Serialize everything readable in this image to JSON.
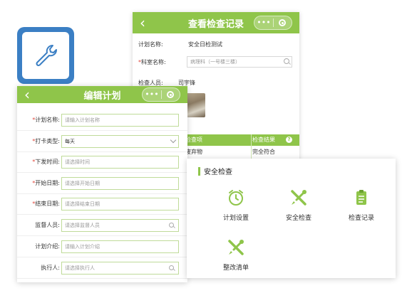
{
  "colors": {
    "accent": "#8fc54a",
    "tile_blue": "#3b7fc4",
    "required": "#e0463b"
  },
  "record_view": {
    "title": "查看检查记录",
    "back_icon": "back-chevron-icon",
    "plan_name_label": "计划名称:",
    "plan_name_value": "安全日检测试",
    "department_label": "科室名称:",
    "department_placeholder": "病理科（一号楼三楼）",
    "inspector_label": "检查人员:",
    "inspector_value": "司宇锋",
    "table": {
      "headers": [
        "检查项",
        "检查结果"
      ],
      "rows": [
        [
          "废弃物",
          "完全符合"
        ]
      ]
    }
  },
  "app_tile": {
    "icon": "wrench-icon"
  },
  "edit_plan": {
    "title": "编辑计划",
    "back_glyph": "‹",
    "capsule_dots": "•••",
    "fields": [
      {
        "label": "计划名称:",
        "required": true,
        "text": "请输入计划名称",
        "kind": "input"
      },
      {
        "label": "打卡类型:",
        "required": true,
        "text": "每天",
        "kind": "select"
      },
      {
        "label": "下发时间:",
        "required": true,
        "text": "请选择时间",
        "kind": "input"
      },
      {
        "label": "开始日期:",
        "required": true,
        "text": "请选择开始日期",
        "kind": "input"
      },
      {
        "label": "结束日期:",
        "required": true,
        "text": "请选择结束日期",
        "kind": "input"
      },
      {
        "label": "监督人员:",
        "required": false,
        "text": "请选择监督人员",
        "kind": "search"
      },
      {
        "label": "计划介绍:",
        "required": false,
        "text": "请输入计划介绍",
        "kind": "input"
      },
      {
        "label": "执行人:",
        "required": false,
        "text": "请选择执行人",
        "kind": "search"
      }
    ]
  },
  "safety": {
    "section_title": "安全检查",
    "items": [
      {
        "label": "计划设置",
        "icon": "alarm-clock-icon"
      },
      {
        "label": "安全检查",
        "icon": "tools-icon"
      },
      {
        "label": "检查记录",
        "icon": "clipboard-icon"
      },
      {
        "label": "整改清单",
        "icon": "tools-icon"
      }
    ]
  }
}
